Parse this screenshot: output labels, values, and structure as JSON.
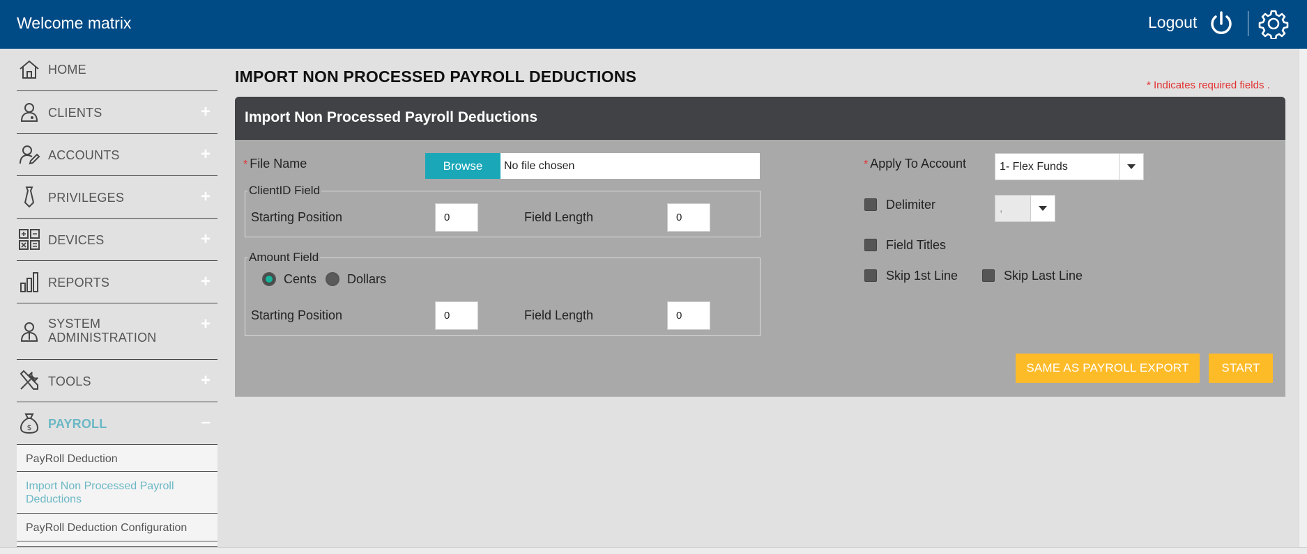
{
  "header": {
    "welcome": "Welcome matrix",
    "logout_label": "Logout",
    "brand_color": "#004a85"
  },
  "sidebar": {
    "items": [
      {
        "label": "HOME",
        "icon": "home-icon"
      },
      {
        "label": "CLIENTS",
        "icon": "user-icon",
        "expander": "+"
      },
      {
        "label": "ACCOUNTS",
        "icon": "user-edit-icon",
        "expander": "+"
      },
      {
        "label": "PRIVILEGES",
        "icon": "tie-icon",
        "expander": "+"
      },
      {
        "label": "DEVICES",
        "icon": "calculator-icon",
        "expander": "+"
      },
      {
        "label": "REPORTS",
        "icon": "bar-chart-icon",
        "expander": "+"
      },
      {
        "label_line1": "SYSTEM",
        "label_line2": "ADMINISTRATION",
        "icon": "admin-user-icon",
        "expander": "+"
      },
      {
        "label": "TOOLS",
        "icon": "tools-icon",
        "expander": "+"
      },
      {
        "label": "PAYROLL",
        "icon": "money-bag-icon",
        "expander": "–"
      }
    ],
    "payroll_subitems": [
      {
        "label": "PayRoll Deduction"
      },
      {
        "label_line1": "Import Non Processed Payroll",
        "label_line2": "Deductions"
      },
      {
        "label": "PayRoll Deduction Configuration"
      }
    ],
    "active_color": "#6bb8c5"
  },
  "main": {
    "page_title": "IMPORT NON PROCESSED PAYROLL DEDUCTIONS",
    "required_note": "Indicates required fields .",
    "required_mark": "*",
    "panel_title": "Import Non Processed Payroll Deductions",
    "file": {
      "label": "File Name",
      "browse_label": "Browse",
      "file_value": "No file chosen"
    },
    "client_id_field": {
      "legend": "ClientID Field",
      "start_label": "Starting Position",
      "start_value": "0",
      "length_label": "Field Length",
      "length_value": "0"
    },
    "amount_field": {
      "legend": "Amount Field",
      "radio_cents": "Cents",
      "radio_dollars": "Dollars",
      "selected": "Cents",
      "start_label": "Starting Position",
      "start_value": "0",
      "length_label": "Field Length",
      "length_value": "0"
    },
    "apply_to_account": {
      "label": "Apply To Account",
      "value": "1- Flex Funds"
    },
    "delimiter": {
      "label": "Delimiter",
      "value": ",",
      "checked": false
    },
    "field_titles": {
      "label": "Field Titles",
      "checked": false
    },
    "skip_first": {
      "label": "Skip 1st Line",
      "checked": false
    },
    "skip_last": {
      "label": "Skip Last Line",
      "checked": false
    },
    "buttons": {
      "same_as_export": "SAME AS PAYROLL EXPORT",
      "start": "START"
    },
    "accent_color": "#fdbb28",
    "browse_color": "#1aa7b8"
  }
}
